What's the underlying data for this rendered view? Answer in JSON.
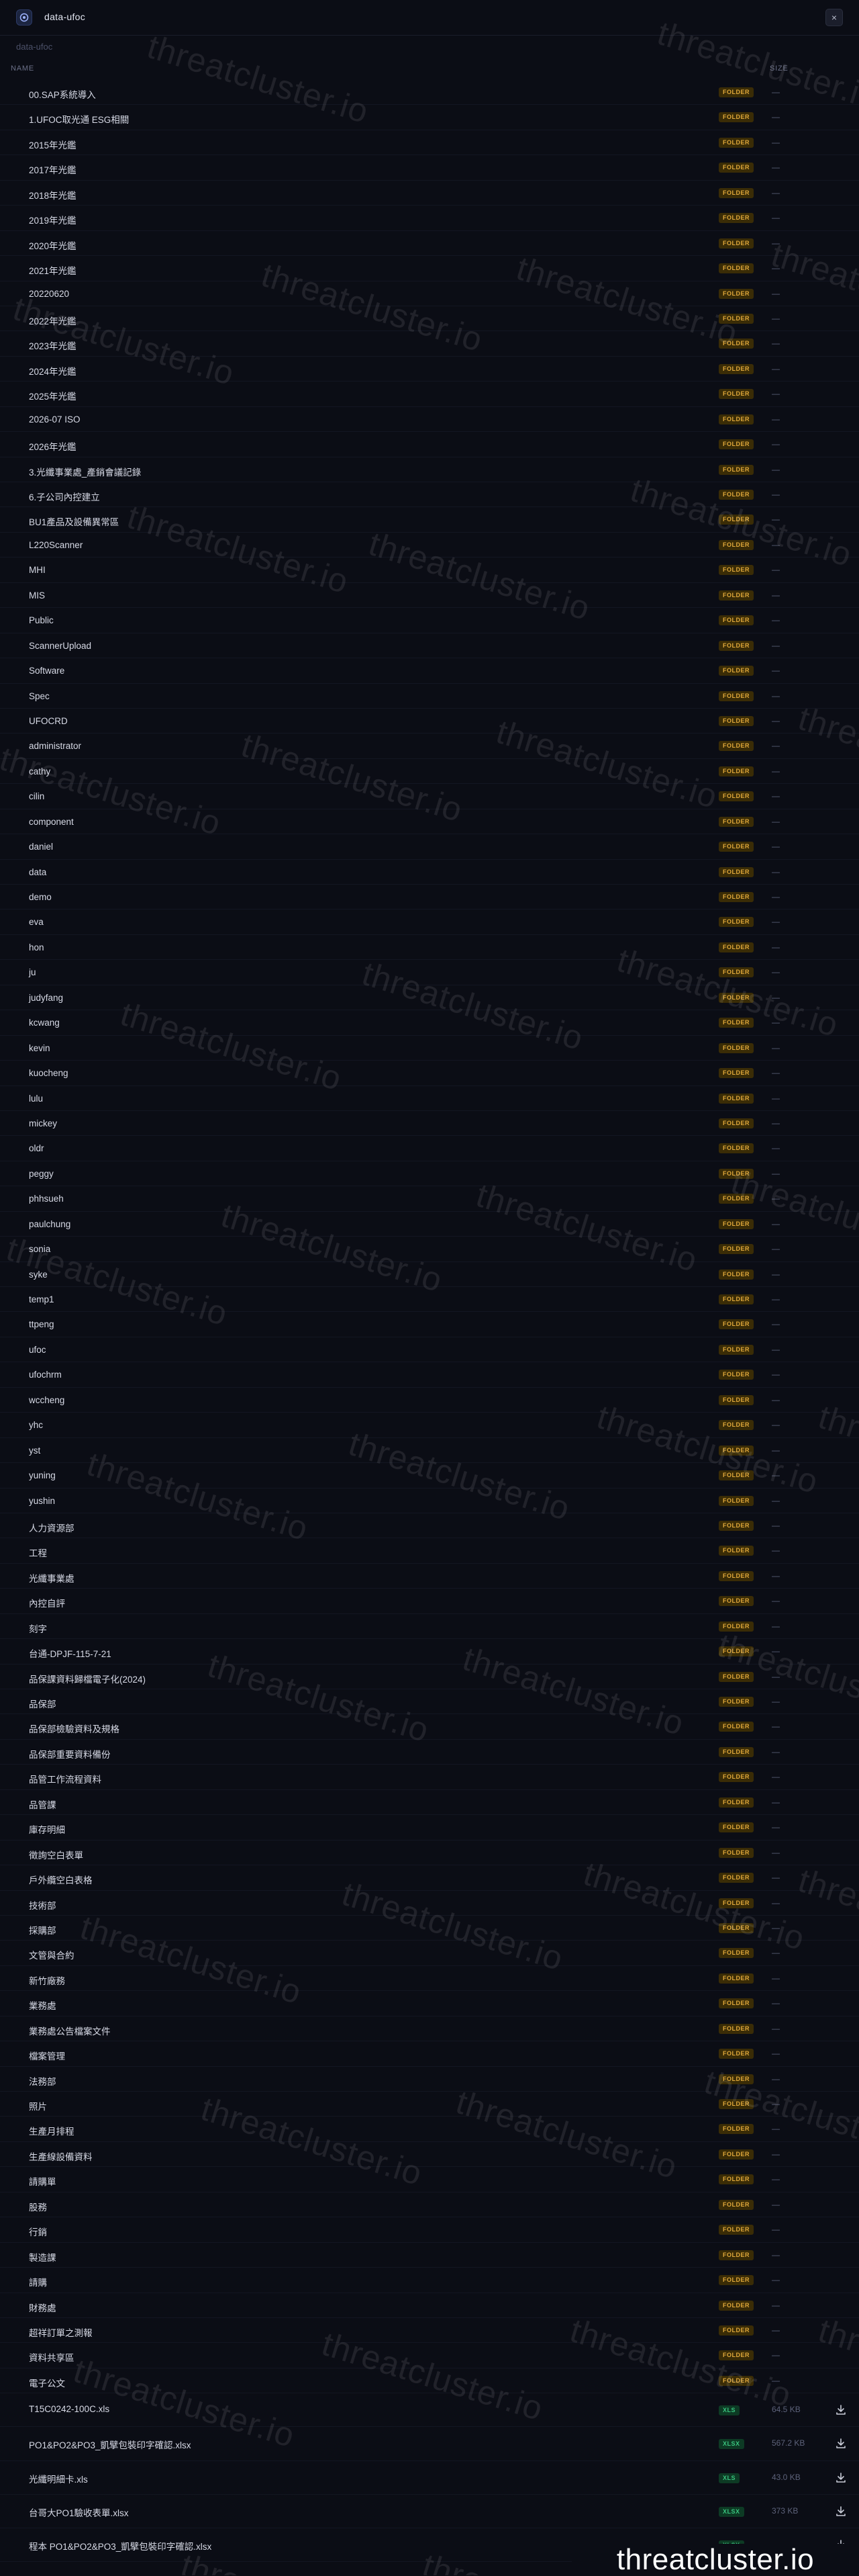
{
  "window": {
    "title": "data-ufoc",
    "close_label": "×"
  },
  "breadcrumb": "data-ufoc",
  "columns": {
    "name": "NAME",
    "size": "SIZE"
  },
  "folder_badge": "FOLDER",
  "folder_size": "—",
  "folders": [
    "00.SAP系統導入",
    "1.UFOC取光通 ESG相關",
    "2015年光鑑",
    "2017年光鑑",
    "2018年光鑑",
    "2019年光鑑",
    "2020年光鑑",
    "2021年光鑑",
    "20220620",
    "2022年光鑑",
    "2023年光鑑",
    "2024年光鑑",
    "2025年光鑑",
    "2026-07 ISO",
    "2026年光鑑",
    "3.光纖事業處_產銷會議記錄",
    "6.子公司內控建立",
    "BU1產品及設備異常區",
    "L220Scanner",
    "MHI",
    "MIS",
    "Public",
    "ScannerUpload",
    "Software",
    "Spec",
    "UFOCRD",
    "administrator",
    "cathy",
    "cilin",
    "component",
    "daniel",
    "data",
    "demo",
    "eva",
    "hon",
    "ju",
    "judyfang",
    "kcwang",
    "kevin",
    "kuocheng",
    "lulu",
    "mickey",
    "oldr",
    "peggy",
    "phhsueh",
    "paulchung",
    "sonia",
    "syke",
    "temp1",
    "ttpeng",
    "ufoc",
    "ufochrm",
    "wccheng",
    "yhc",
    "yst",
    "yuning",
    "yushin",
    "人力資源部",
    "工程",
    "光纖事業處",
    "內控自評",
    "刻字",
    "台通-DPJF-115-7-21",
    "品保課資料歸檔電子化(2024)",
    "品保部",
    "品保部檢驗資料及規格",
    "品保部重要資料備份",
    "品管工作流程資料",
    "品管課",
    "庫存明細",
    "徵詢空白表單",
    "戶外纜空白表格",
    "技術部",
    "採購部",
    "文管與合約",
    "新竹廠務",
    "業務處",
    "業務處公告檔案文件",
    "檔案管理",
    "法務部",
    "照片",
    "生產月排程",
    "生產線設備資料",
    "請購單",
    "股務",
    "行銷",
    "製造課",
    "請購",
    "財務處",
    "超祥訂單之測報",
    "資料共享區",
    "電子公文"
  ],
  "files": [
    {
      "name": "T15C0242-100C.xls",
      "type": "XLS",
      "size": "64.5 KB"
    },
    {
      "name": "PO1&PO2&PO3_凱擘包裝印字確認.xlsx",
      "type": "XLSX",
      "size": "567.2 KB"
    },
    {
      "name": "光纖明細卡.xls",
      "type": "XLS",
      "size": "43.0 KB"
    },
    {
      "name": "台哥大PO1驗收表單.xlsx",
      "type": "XLSX",
      "size": "373 KB"
    },
    {
      "name": "程本 PO1&PO2&PO3_凱擘包裝印字確認.xlsx",
      "type": "XLSX",
      "size": ""
    }
  ],
  "watermark_text": "threatcluster.io",
  "brand_text": "threatcluster.io"
}
